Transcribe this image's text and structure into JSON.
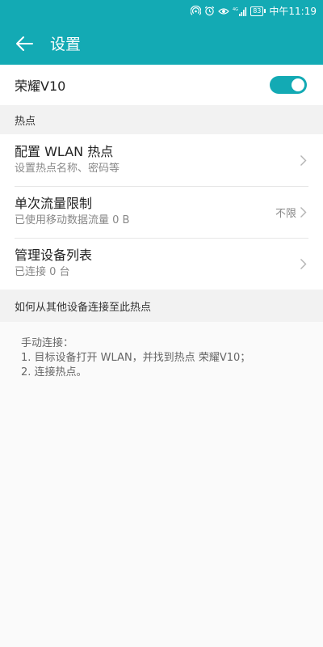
{
  "status_bar": {
    "battery": "83",
    "time": "中午11:19",
    "icons": [
      "hotspot-icon",
      "alarm-icon",
      "eye-icon",
      "signal-4g-icon",
      "battery-icon"
    ]
  },
  "header": {
    "title": "设置",
    "back_icon": "arrow-left-icon"
  },
  "main_toggle": {
    "label": "荣耀V10",
    "enabled": true
  },
  "hotspot_section": {
    "header": "热点",
    "items": [
      {
        "title": "配置 WLAN 热点",
        "subtitle": "设置热点名称、密码等",
        "value": ""
      },
      {
        "title": "单次流量限制",
        "subtitle": "已使用移动数据流量 0 B",
        "value": "不限"
      },
      {
        "title": "管理设备列表",
        "subtitle": "已连接 0 台",
        "value": ""
      }
    ]
  },
  "help_section": {
    "header": "如何从其他设备连接至此热点",
    "lines": [
      "手动连接：",
      "1. 目标设备打开 WLAN，并找到热点 荣耀V10；",
      "2. 连接热点。"
    ]
  },
  "colors": {
    "accent": "#13aab4",
    "background": "#fafafa",
    "section_bg": "#f2f2f2"
  }
}
